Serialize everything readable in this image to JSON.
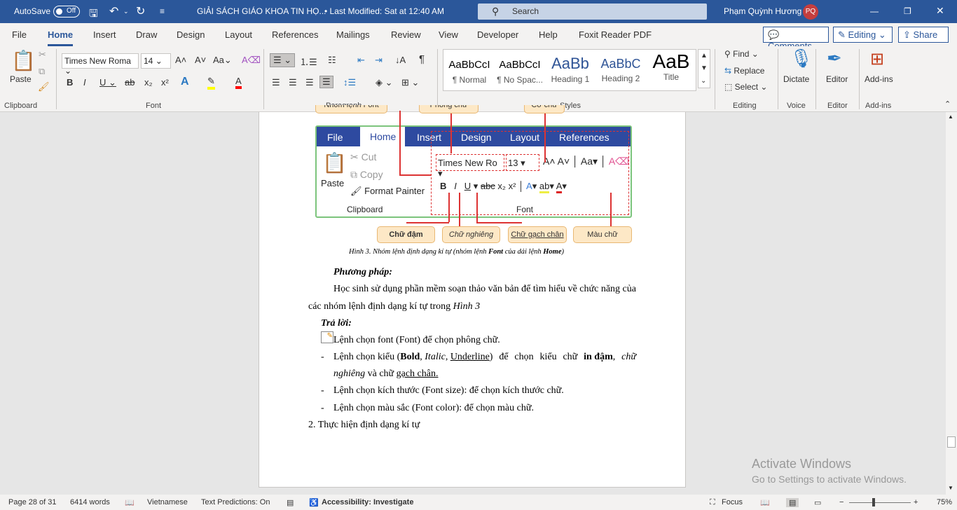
{
  "titlebar": {
    "autosave": "AutoSave",
    "autosave_state": "Off",
    "doc_title": "GIẢI SÁCH GIÁO KHOA TIN HỌ...",
    "last_modified": "• Last Modified: Sat at 12:40 AM",
    "search_placeholder": "Search",
    "user": "Phạm Quỳnh Hương",
    "initials": "PQ"
  },
  "tabs": [
    "File",
    "Home",
    "Insert",
    "Draw",
    "Design",
    "Layout",
    "References",
    "Mailings",
    "Review",
    "View",
    "Developer",
    "Help",
    "Foxit Reader PDF"
  ],
  "tab_buttons": {
    "comments": "Comments",
    "editing": "Editing",
    "share": "Share"
  },
  "ribbon": {
    "clipboard": {
      "paste": "Paste",
      "label": "Clipboard"
    },
    "font": {
      "name": "Times New Roma",
      "size": "14",
      "label": "Font",
      "colors": {
        "highlight": "#ffff00",
        "font": "#ff0000"
      }
    },
    "paragraph": {
      "label": "Paragraph"
    },
    "styles": {
      "label": "Styles",
      "items": [
        {
          "preview": "AaBbCcI",
          "name": "¶ Normal"
        },
        {
          "preview": "AaBbCcI",
          "name": "¶ No Spac..."
        },
        {
          "preview": "AaBb",
          "name": "Heading 1"
        },
        {
          "preview": "AaBbC",
          "name": "Heading 2"
        },
        {
          "preview": "AaB",
          "name": "Title"
        }
      ]
    },
    "editing": {
      "find": "Find",
      "replace": "Replace",
      "select": "Select",
      "label": "Editing"
    },
    "voice": {
      "dictate": "Dictate",
      "label": "Voice"
    },
    "editor": {
      "editor": "Editor",
      "label": "Editor"
    },
    "addins": {
      "addins": "Add-ins",
      "label": "Add-ins"
    }
  },
  "figure": {
    "callouts_top": [
      "Nhóm lệnh Font",
      "Phông chữ",
      "Cỡ chữ"
    ],
    "tabs": [
      "File",
      "Home",
      "Insert",
      "Design",
      "Layout",
      "References"
    ],
    "clip": {
      "cut": "Cut",
      "copy": "Copy",
      "paste": "Paste",
      "format_painter": "Format Painter",
      "label": "Clipboard"
    },
    "font": {
      "name": "Times New Ro",
      "size": "13",
      "label": "Font"
    },
    "callouts_bottom": [
      "Chữ đậm",
      "Chữ nghiêng",
      "Chữ gạch chân",
      "Màu chữ"
    ],
    "caption_a": "Hình 3. Nhóm lệnh định dạng kí tự (nhóm lệnh ",
    "caption_b": "Font",
    "caption_c": " của dải lệnh ",
    "caption_d": "Home",
    "caption_e": ")"
  },
  "body": {
    "method_title": "Phương pháp:",
    "method_1": "Học sinh sử dụng phần mềm soạn thảo văn bản để tìm hiểu về chức năng của",
    "method_2a": "các nhóm lệnh định dạng kí tự trong ",
    "method_2b": "Hình 3",
    ".": ".",
    "answer_title": "Trả lời:",
    "l1": "Lệnh chọn font (Font) để chọn phông chữ.",
    "l2a": "Lệnh chọn kiểu (",
    "l2b": "Bold",
    ", ": ", ",
    "l2c": "Italic",
    "l2d": "Underline",
    "l2e": ") để chọn kiểu chữ ",
    "l2f": "in đậm",
    "l2g": "chữ",
    "l2h": "nghiêng",
    "l2i": " và chữ ",
    "l2j": "gạch chân.",
    "l3": "Lệnh chọn kích thước (Font size): để chọn kích thước chữ.",
    "l4": "Lệnh chọn màu sắc (Font color): để chọn màu chữ.",
    "l5": "2. Thực hiện định dạng kí tự"
  },
  "watermark": {
    "line1": "Activate Windows",
    "line2": "Go to Settings to activate Windows."
  },
  "status": {
    "page": "Page 28 of 31",
    "words": "6414 words",
    "language": "Vietnamese",
    "predictions": "Text Predictions: On",
    "accessibility": "Accessibility: Investigate",
    "focus": "Focus",
    "zoom": "75%",
    "zoom_value": 75
  }
}
